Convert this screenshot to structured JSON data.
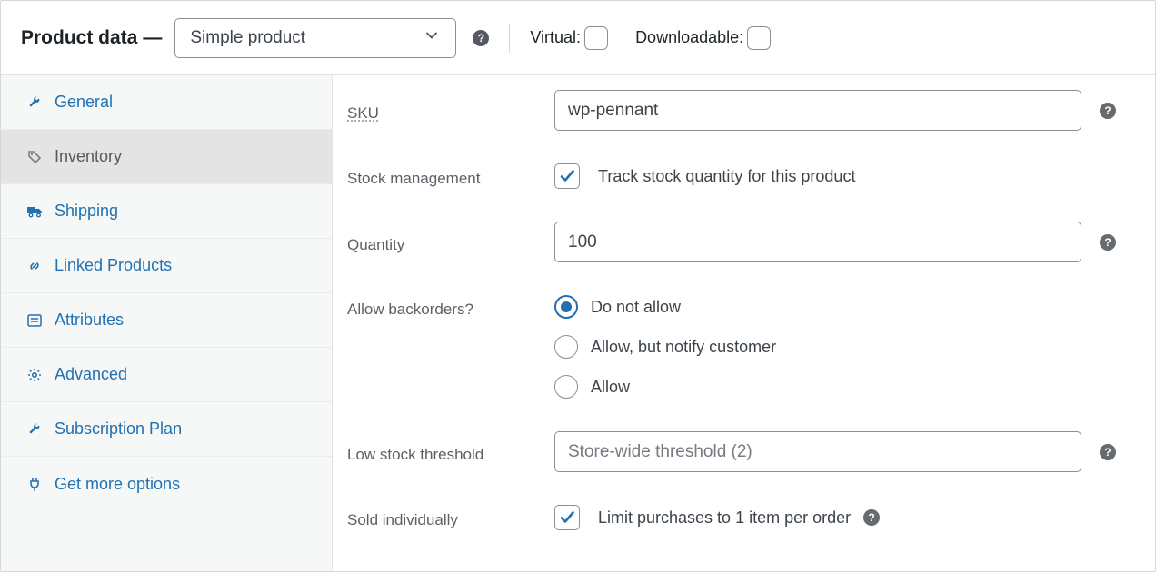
{
  "header": {
    "title": "Product data",
    "dash": "—",
    "product_type": "Simple product",
    "virtual_label": "Virtual:",
    "downloadable_label": "Downloadable:"
  },
  "sidebar": {
    "items": [
      {
        "label": "General",
        "icon": "wrench"
      },
      {
        "label": "Inventory",
        "icon": "tag",
        "active": true
      },
      {
        "label": "Shipping",
        "icon": "truck"
      },
      {
        "label": "Linked Products",
        "icon": "link"
      },
      {
        "label": "Attributes",
        "icon": "list"
      },
      {
        "label": "Advanced",
        "icon": "gear"
      },
      {
        "label": "Subscription Plan",
        "icon": "wrench"
      },
      {
        "label": "Get more options",
        "icon": "plug"
      }
    ]
  },
  "form": {
    "sku_label": "SKU",
    "sku_value": "wp-pennant",
    "stock_mgmt_label": "Stock management",
    "stock_mgmt_check_label": "Track stock quantity for this product",
    "quantity_label": "Quantity",
    "quantity_value": "100",
    "backorders_label": "Allow backorders?",
    "backorders_options": {
      "no": "Do not allow",
      "notify": "Allow, but notify customer",
      "yes": "Allow"
    },
    "low_stock_label": "Low stock threshold",
    "low_stock_placeholder": "Store-wide threshold (2)",
    "sold_indiv_label": "Sold individually",
    "sold_indiv_check_label": "Limit purchases to 1 item per order"
  },
  "colors": {
    "link": "#2271b1",
    "border": "#8c8f94",
    "accent": "#1f6fb2"
  }
}
